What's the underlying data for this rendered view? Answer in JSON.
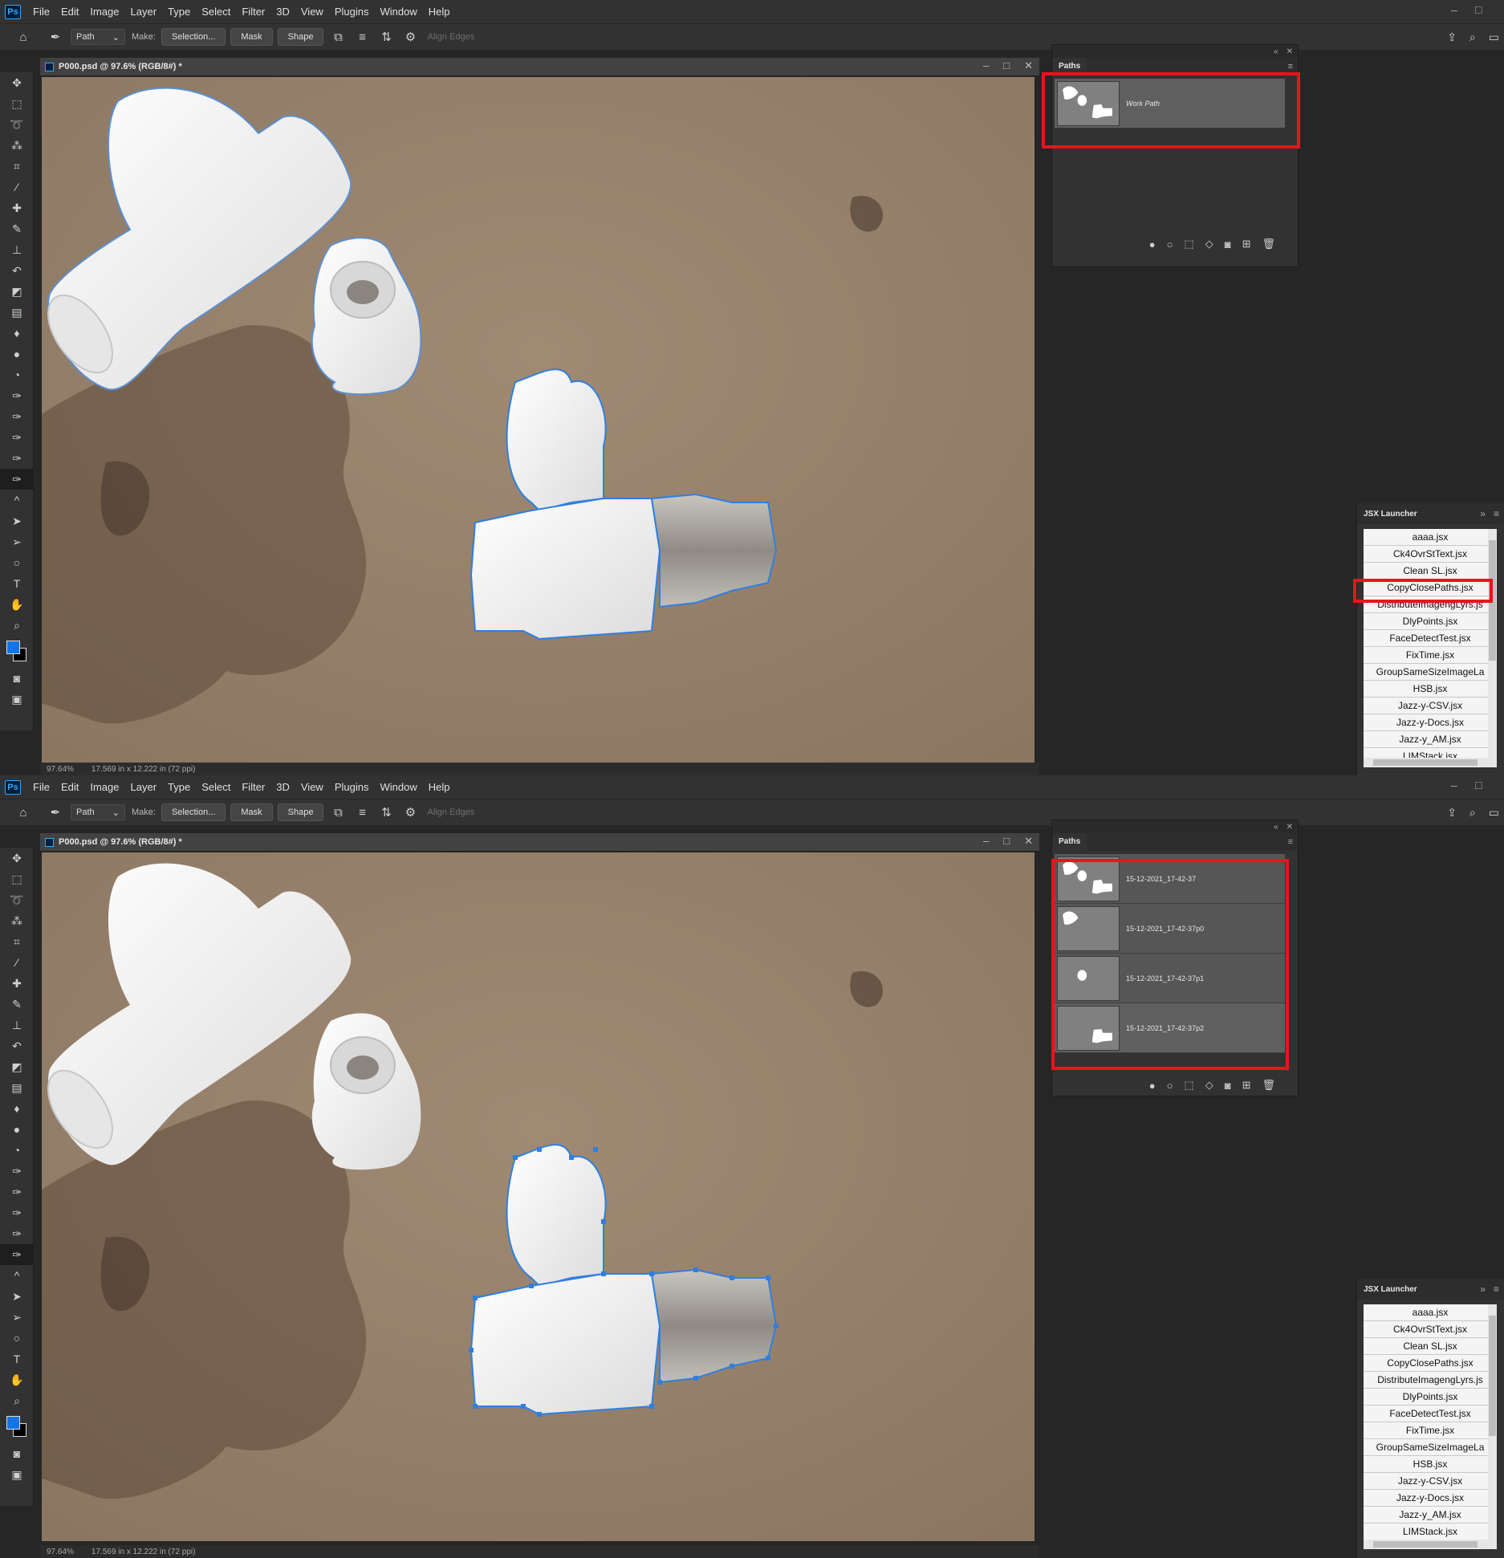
{
  "menu": [
    "File",
    "Edit",
    "Image",
    "Layer",
    "Type",
    "Select",
    "Filter",
    "3D",
    "View",
    "Plugins",
    "Window",
    "Help"
  ],
  "ps_logo": "Ps",
  "options": {
    "mode": "Path",
    "make_label": "Make:",
    "selection_btn": "Selection...",
    "mask_btn": "Mask",
    "shape_btn": "Shape",
    "align_edges": "Align Edges"
  },
  "document": {
    "title": "P000.psd @ 97.6% (RGB/8#) *",
    "zoom": "97.64%",
    "size": "17.569 in x 12.222 in (72 ppi)"
  },
  "paths_panel": {
    "tab": "Paths",
    "top_rows": [
      {
        "name": "Work Path",
        "thumb": "all"
      }
    ],
    "bottom_rows": [
      {
        "name": "15-12-2021_17-42-37",
        "thumb": "all"
      },
      {
        "name": "15-12-2021_17-42-37p0",
        "thumb": "tee"
      },
      {
        "name": "15-12-2021_17-42-37p1",
        "thumb": "cap"
      },
      {
        "name": "15-12-2021_17-42-37p2",
        "thumb": "valve"
      }
    ]
  },
  "jsx_launcher": {
    "title": "JSX Launcher",
    "items": [
      "aaaa.jsx",
      "Ck4OvrStText.jsx",
      "Clean SL.jsx",
      "CopyClosePaths.jsx",
      "DistributeImagengLyrs.js",
      "DlyPoints.jsx",
      "FaceDetectTest.jsx",
      "FixTime.jsx",
      "GroupSameSizeImageLa",
      "HSB.jsx",
      "Jazz-y-CSV.jsx",
      "Jazz-y-Docs.jsx",
      "Jazz-y_AM.jsx",
      "LIMStack.jsx"
    ],
    "highlighted": "CopyClosePaths.jsx"
  },
  "colors": {
    "highlight_red": "#e8141c",
    "path_blue": "#2f7fe0",
    "foreground": "#1473e6"
  }
}
